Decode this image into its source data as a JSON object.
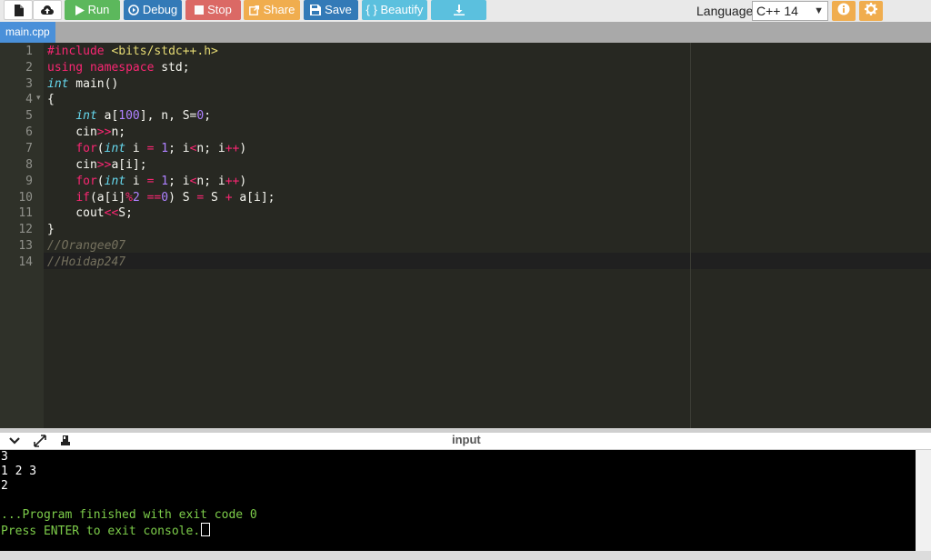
{
  "toolbar": {
    "run_label": "Run",
    "debug_label": "Debug",
    "stop_label": "Stop",
    "share_label": "Share",
    "save_label": "Save",
    "beautify_label": "{ } Beautify",
    "language_label": "Language",
    "language_value": "C++ 14",
    "colors": {
      "run": "#5cb85c",
      "debug": "#337ab7",
      "stop": "#d9534f",
      "share": "#f0ad4e",
      "save": "#337ab7",
      "beautify": "#5bc0de",
      "download": "#5bc0de",
      "info": "#f0ad4e",
      "settings": "#f0ad4e"
    },
    "icons": [
      "new-file-icon",
      "upload-icon",
      "play-icon",
      "debug-icon",
      "stop-icon",
      "share-icon",
      "save-icon",
      "download-icon",
      "info-icon",
      "gear-icon"
    ]
  },
  "tab": {
    "label": "main.cpp"
  },
  "editor": {
    "line_numbers": [
      "1",
      "2",
      "3",
      "4",
      "5",
      "6",
      "7",
      "8",
      "9",
      "10",
      "11",
      "12",
      "13",
      "14"
    ],
    "fold_marker_line": "4"
  },
  "console": {
    "header_title": "input",
    "lines": [
      "3",
      "1 2 3",
      "2",
      "",
      "...Program finished with exit code 0",
      "Press ENTER to exit console."
    ]
  }
}
